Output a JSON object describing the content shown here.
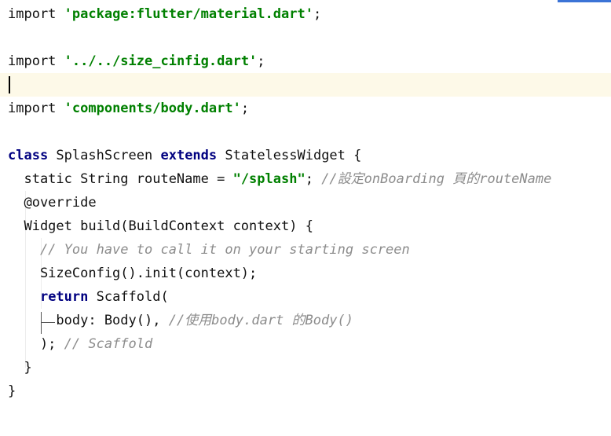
{
  "editor": {
    "accent_color": "#3b73d6",
    "active_line_color": "#fdf9e8",
    "lines": [
      {
        "segments": [
          {
            "t": "import ",
            "c": "plain"
          },
          {
            "t": "'package:flutter/material.dart'",
            "c": "str"
          },
          {
            "t": ";",
            "c": "plain"
          }
        ]
      },
      {
        "segments": []
      },
      {
        "segments": [
          {
            "t": "import ",
            "c": "plain"
          },
          {
            "t": "'../../size_cinfig.dart'",
            "c": "str"
          },
          {
            "t": ";",
            "c": "plain"
          }
        ]
      },
      {
        "segments": []
      },
      {
        "segments": [
          {
            "t": "import ",
            "c": "plain"
          },
          {
            "t": "'components/body.dart'",
            "c": "str"
          },
          {
            "t": ";",
            "c": "plain"
          }
        ]
      },
      {
        "segments": []
      },
      {
        "segments": [
          {
            "t": "class ",
            "c": "kw"
          },
          {
            "t": "SplashScreen ",
            "c": "plain"
          },
          {
            "t": "extends ",
            "c": "kw"
          },
          {
            "t": "StatelessWidget {",
            "c": "plain"
          }
        ]
      },
      {
        "segments": [
          {
            "t": "  static String routeName = ",
            "c": "plain"
          },
          {
            "t": "\"/splash\"",
            "c": "str"
          },
          {
            "t": "; ",
            "c": "plain"
          },
          {
            "t": "//設定onBoarding 頁的routeName",
            "c": "cmt"
          }
        ]
      },
      {
        "segments": [
          {
            "t": "  @override",
            "c": "plain"
          }
        ]
      },
      {
        "segments": [
          {
            "t": "  Widget build(BuildContext context) {",
            "c": "plain"
          }
        ]
      },
      {
        "segments": [
          {
            "t": "    // You have to call it on your starting screen",
            "c": "cmt"
          }
        ]
      },
      {
        "segments": [
          {
            "t": "    SizeConfig().init(context);",
            "c": "plain"
          }
        ]
      },
      {
        "segments": [
          {
            "t": "    ",
            "c": "plain"
          },
          {
            "t": "return ",
            "c": "kw"
          },
          {
            "t": "Scaffold(",
            "c": "plain"
          }
        ]
      },
      {
        "segments": [
          {
            "t": "      body: Body(), ",
            "c": "plain"
          },
          {
            "t": "//使用body.dart 的Body()",
            "c": "cmt"
          }
        ]
      },
      {
        "segments": [
          {
            "t": "    ); ",
            "c": "plain"
          },
          {
            "t": "// Scaffold",
            "c": "cmt"
          }
        ]
      },
      {
        "segments": [
          {
            "t": "  }",
            "c": "plain"
          }
        ]
      },
      {
        "segments": [
          {
            "t": "}",
            "c": "plain"
          }
        ]
      }
    ]
  }
}
